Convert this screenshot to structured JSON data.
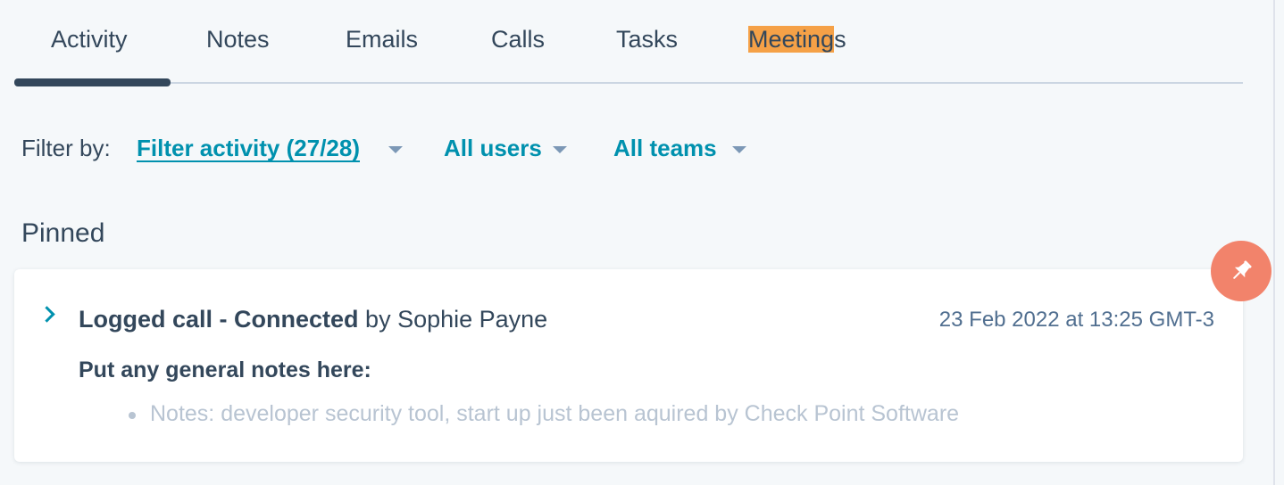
{
  "tabs": [
    {
      "label": "Activity",
      "active": true
    },
    {
      "label": "Notes",
      "active": false
    },
    {
      "label": "Emails",
      "active": false
    },
    {
      "label": "Calls",
      "active": false
    },
    {
      "label": "Tasks",
      "active": false
    },
    {
      "label_highlighted": "Meeting",
      "label_rest": "s",
      "active": false
    }
  ],
  "filters": {
    "label": "Filter by:",
    "activity": "Filter activity (27/28)",
    "users": "All users",
    "teams": "All teams"
  },
  "pinned": {
    "title": "Pinned",
    "card": {
      "title_bold": "Logged call - Connected",
      "title_by": "by Sophie Payne",
      "date": "23 Feb 2022 at 13:25 GMT-3",
      "subhead": "Put any general notes here:",
      "note": "Notes: developer security tool, start up just been aquired by Check Point Software"
    },
    "pin_icon": "pin-icon"
  },
  "colors": {
    "accent": "#0091ae",
    "text": "#33475b",
    "highlight": "#f5a147",
    "pin": "#f2836b",
    "background": "#f5f8fa"
  }
}
